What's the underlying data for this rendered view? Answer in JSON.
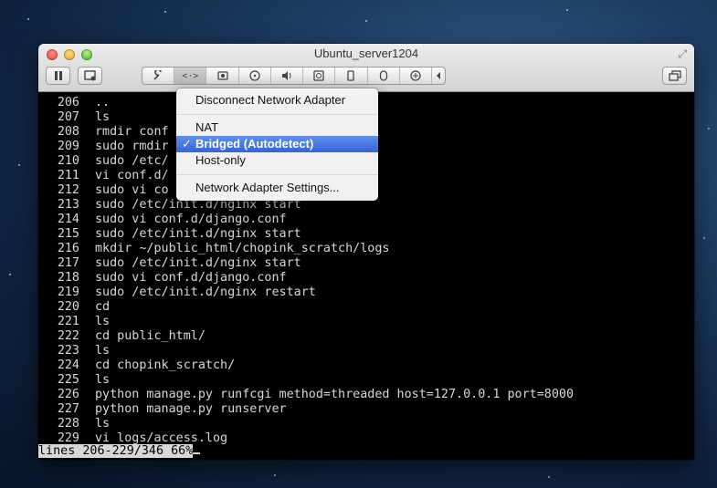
{
  "window": {
    "title": "Ubuntu_server1204"
  },
  "toolbar": {
    "icons": [
      "pause-icon",
      "snapshot-icon",
      "wrench-icon",
      "network-icon",
      "hard-disk-icon",
      "cd-icon",
      "audio-icon",
      "camera-icon",
      "usb-icon",
      "mouse-icon",
      "shared-folders-icon",
      "chevron-left-icon",
      "display-icon"
    ]
  },
  "terminal": {
    "lines": [
      {
        "num": "206",
        "cmd": ".."
      },
      {
        "num": "207",
        "cmd": "ls"
      },
      {
        "num": "208",
        "cmd": "rmdir conf"
      },
      {
        "num": "209",
        "cmd": "sudo rmdir"
      },
      {
        "num": "210",
        "cmd": "sudo /etc/"
      },
      {
        "num": "211",
        "cmd": "vi conf.d/"
      },
      {
        "num": "212",
        "cmd": "sudo vi co"
      },
      {
        "num": "213",
        "cmd": "sudo /etc/init.d/nginx start"
      },
      {
        "num": "214",
        "cmd": "sudo vi conf.d/django.conf"
      },
      {
        "num": "215",
        "cmd": "sudo /etc/init.d/nginx start"
      },
      {
        "num": "216",
        "cmd": "mkdir ~/public_html/chopink_scratch/logs"
      },
      {
        "num": "217",
        "cmd": "sudo /etc/init.d/nginx start"
      },
      {
        "num": "218",
        "cmd": "sudo vi conf.d/django.conf"
      },
      {
        "num": "219",
        "cmd": "sudo /etc/init.d/nginx restart"
      },
      {
        "num": "220",
        "cmd": "cd"
      },
      {
        "num": "221",
        "cmd": "ls"
      },
      {
        "num": "222",
        "cmd": "cd public_html/"
      },
      {
        "num": "223",
        "cmd": "ls"
      },
      {
        "num": "224",
        "cmd": "cd chopink_scratch/"
      },
      {
        "num": "225",
        "cmd": "ls"
      },
      {
        "num": "226",
        "cmd": "python manage.py runfcgi method=threaded host=127.0.0.1 port=8000"
      },
      {
        "num": "227",
        "cmd": "python manage.py runserver"
      },
      {
        "num": "228",
        "cmd": "ls"
      },
      {
        "num": "229",
        "cmd": "vi logs/access.log"
      }
    ],
    "status": "lines 206-229/346 66%"
  },
  "network_menu": {
    "disconnect": "Disconnect Network Adapter",
    "nat": "NAT",
    "bridged": "Bridged (Autodetect)",
    "bridged_check": "✓",
    "host_only": "Host-only",
    "settings": "Network Adapter Settings..."
  }
}
